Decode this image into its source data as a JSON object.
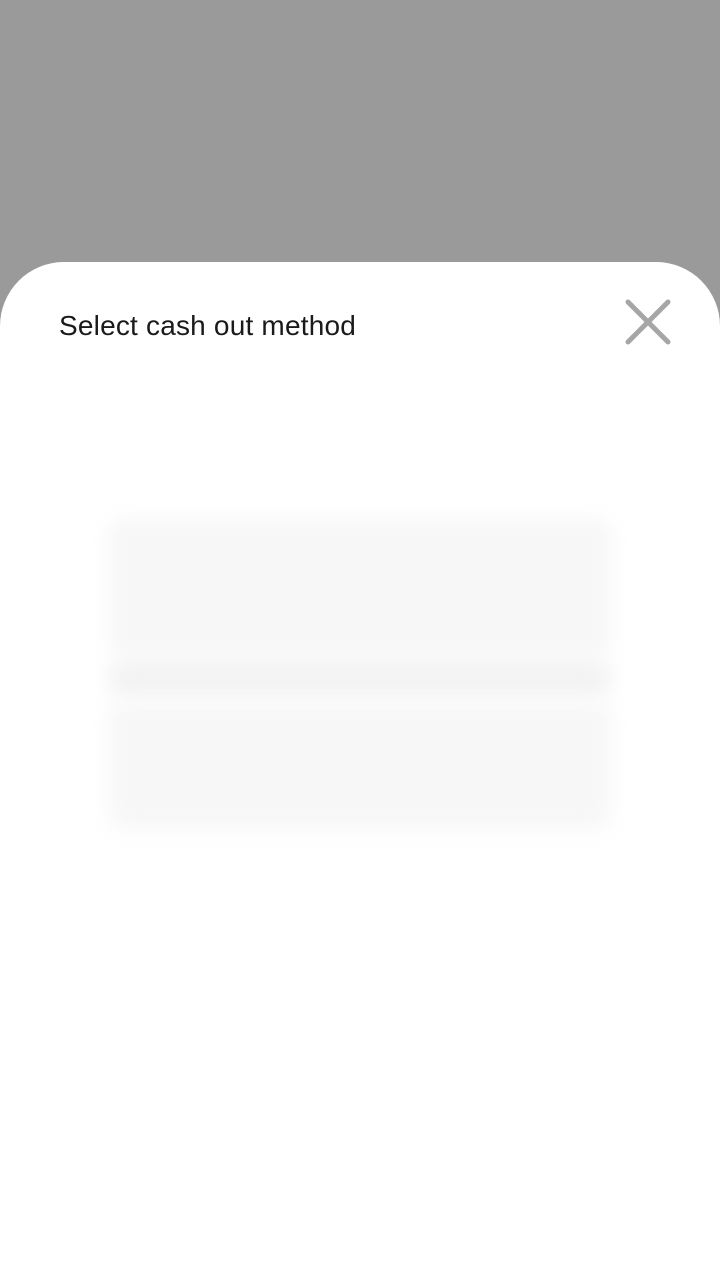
{
  "sheet": {
    "title": "Select cash out method",
    "close_icon": "close-icon"
  },
  "colors": {
    "overlay": "#9a9a9a",
    "sheet_background": "#ffffff",
    "title_text": "#1a1a1a",
    "close_icon": "#a6a6a6",
    "skeleton": "#f7f7f7"
  }
}
